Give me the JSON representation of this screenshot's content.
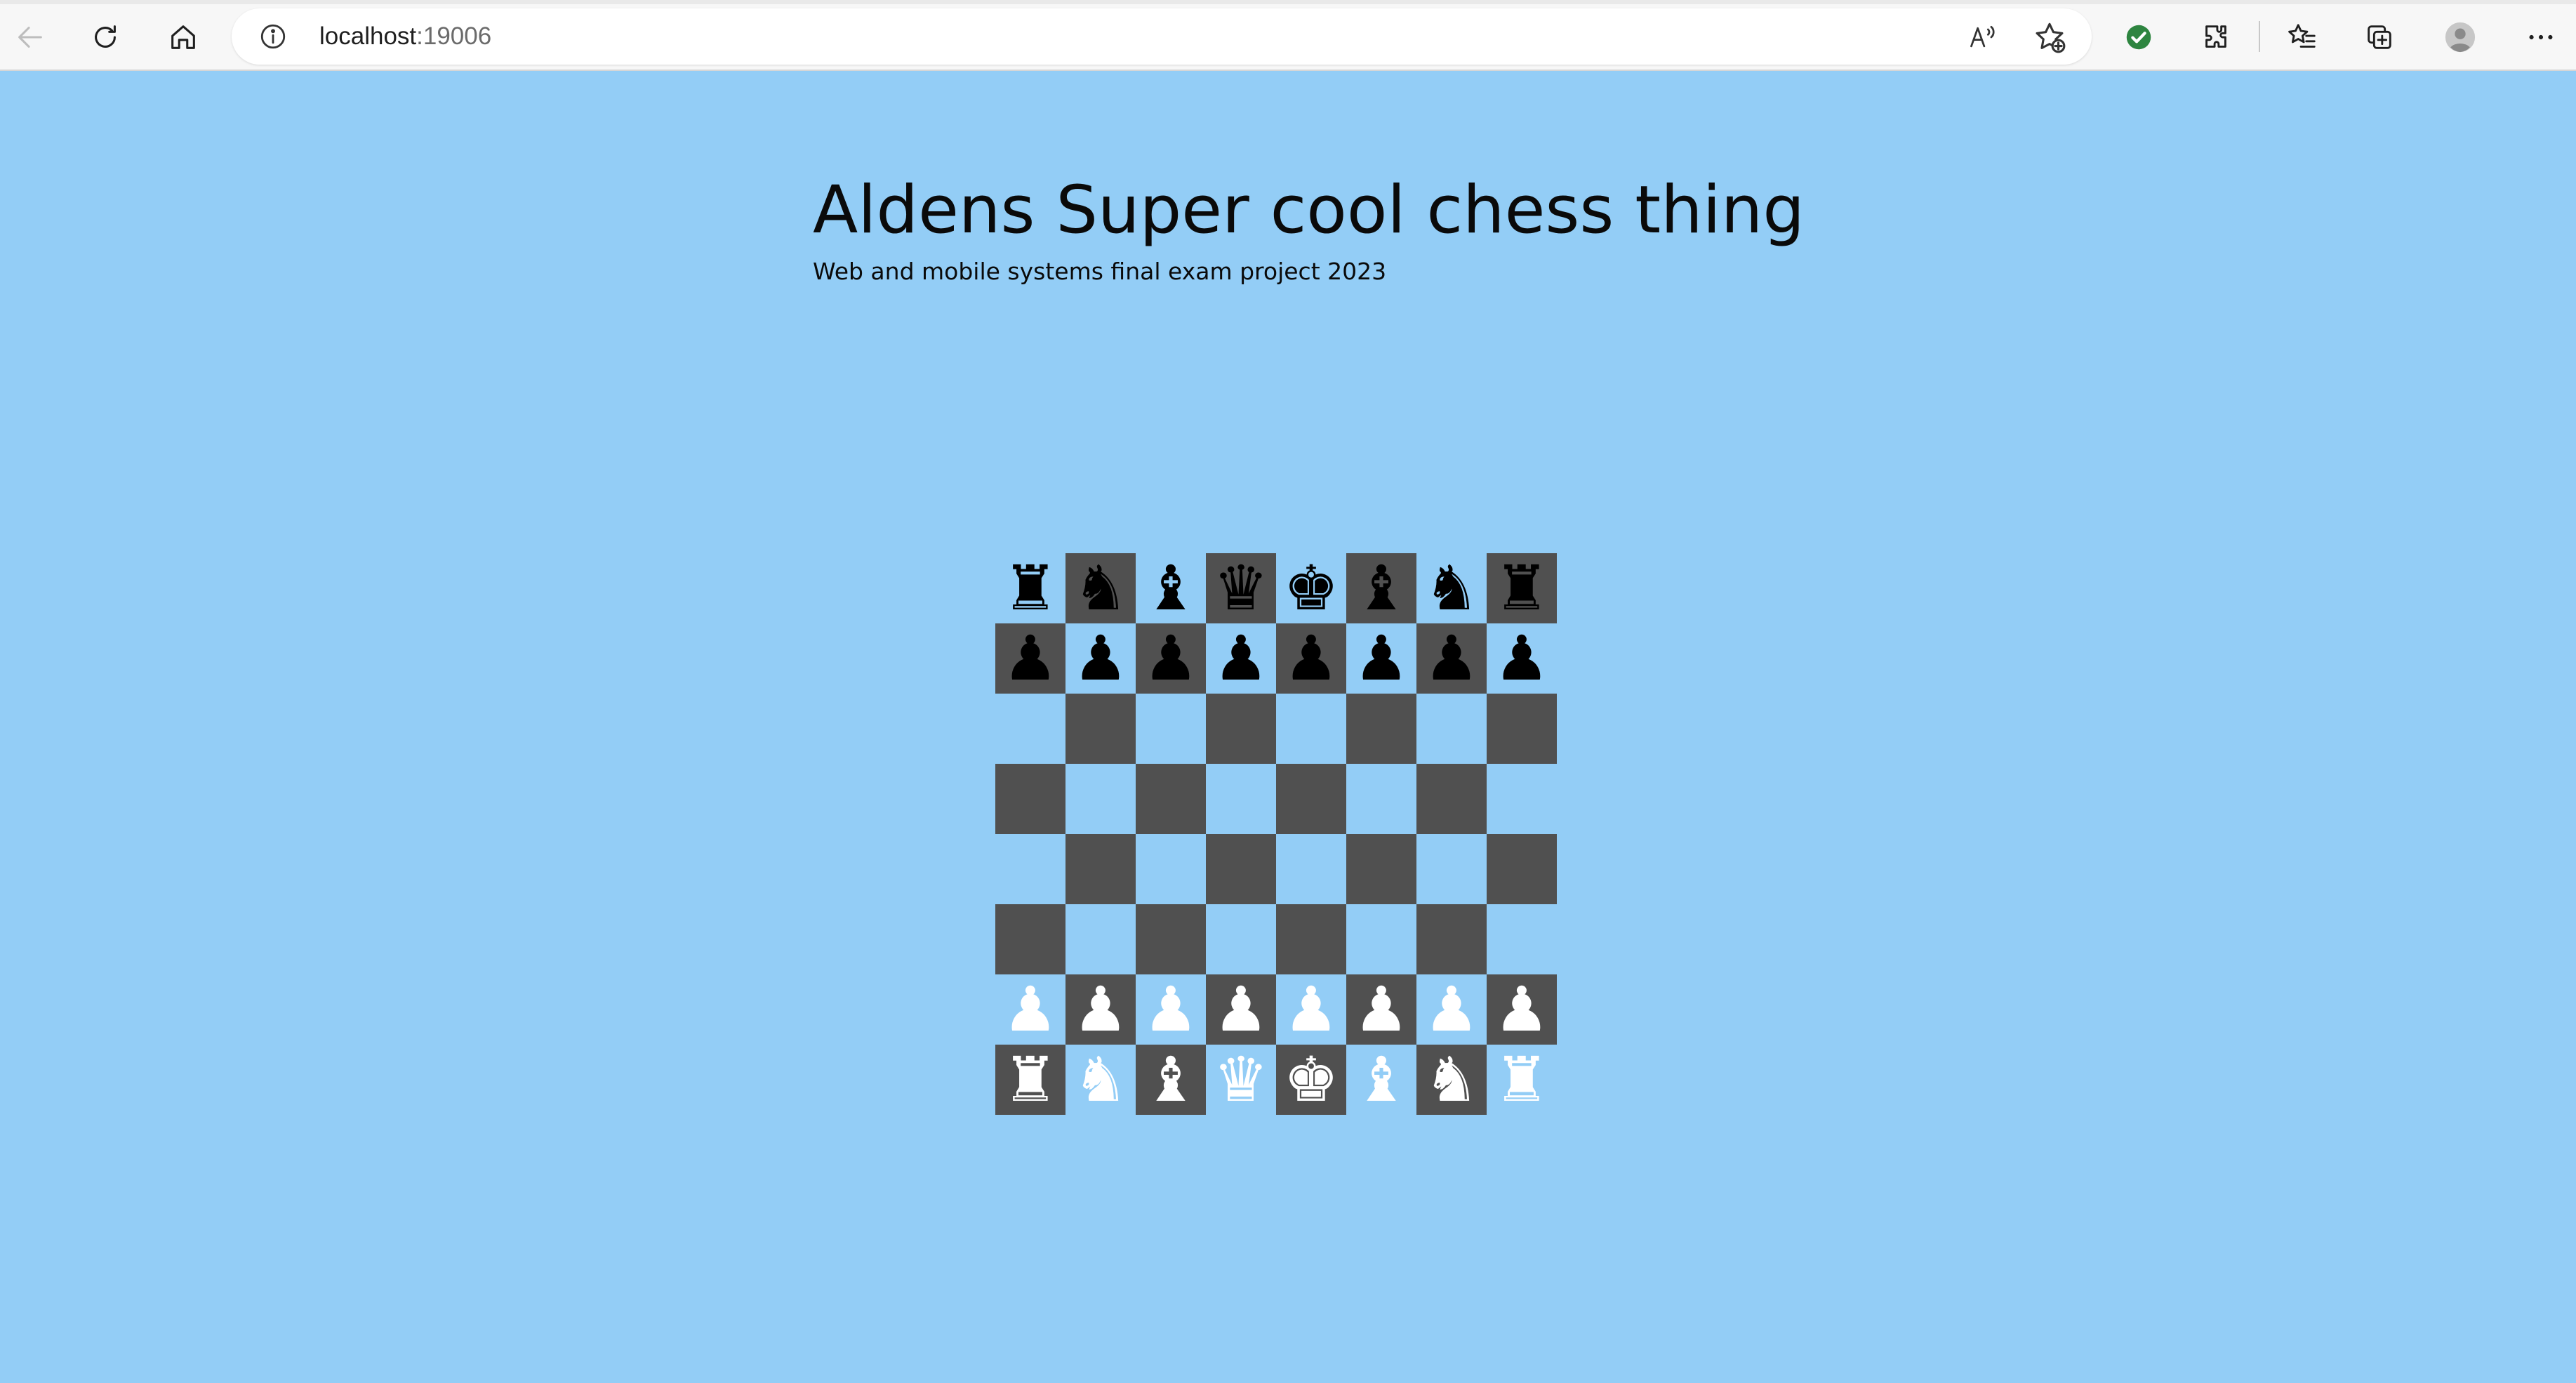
{
  "browser": {
    "url_host": "localhost",
    "url_port": ":19006",
    "read_aloud_label": "A⁾",
    "icons": {
      "back": "back-arrow-icon",
      "refresh": "refresh-icon",
      "home": "home-icon",
      "info": "info-icon",
      "read_aloud": "read-aloud-icon",
      "add_favorite": "add-favorite-icon",
      "extension_check": "check-circle-icon",
      "extensions": "puzzle-icon",
      "favorites": "favorites-icon",
      "collections": "collections-icon",
      "profile": "profile-avatar-icon",
      "more": "more-icon"
    }
  },
  "page": {
    "title": "Aldens Super cool chess thing",
    "subtitle": "Web and mobile systems final exam project 2023"
  },
  "board": {
    "colors": {
      "dark_square": "#505050",
      "light_square": "#93cdf6",
      "page_background": "#93cdf6"
    },
    "ranks": [
      [
        "♜",
        "♞",
        "♝",
        "♛",
        "♚",
        "♝",
        "♞",
        "♜"
      ],
      [
        "♟",
        "♟",
        "♟",
        "♟",
        "♟",
        "♟",
        "♟",
        "♟"
      ],
      [
        "",
        "",
        "",
        "",
        "",
        "",
        "",
        ""
      ],
      [
        "",
        "",
        "",
        "",
        "",
        "",
        "",
        ""
      ],
      [
        "",
        "",
        "",
        "",
        "",
        "",
        "",
        ""
      ],
      [
        "",
        "",
        "",
        "",
        "",
        "",
        "",
        ""
      ],
      [
        "♟",
        "♟",
        "♟",
        "♟",
        "♟",
        "♟",
        "♟",
        "♟"
      ],
      [
        "♜",
        "♞",
        "♝",
        "♛",
        "♚",
        "♝",
        "♞",
        "♜"
      ]
    ],
    "piece_colors": [
      [
        "black",
        "black",
        "black",
        "black",
        "black",
        "black",
        "black",
        "black"
      ],
      [
        "black",
        "black",
        "black",
        "black",
        "black",
        "black",
        "black",
        "black"
      ],
      [
        "",
        "",
        "",
        "",
        "",
        "",
        "",
        ""
      ],
      [
        "",
        "",
        "",
        "",
        "",
        "",
        "",
        ""
      ],
      [
        "",
        "",
        "",
        "",
        "",
        "",
        "",
        ""
      ],
      [
        "",
        "",
        "",
        "",
        "",
        "",
        "",
        ""
      ],
      [
        "white",
        "white",
        "white",
        "white",
        "white",
        "white",
        "white",
        "white"
      ],
      [
        "white",
        "white",
        "white",
        "white",
        "white",
        "white",
        "white",
        "white"
      ]
    ],
    "piece_names": [
      [
        "rook",
        "knight",
        "bishop",
        "queen",
        "king",
        "bishop",
        "knight",
        "rook"
      ],
      [
        "pawn",
        "pawn",
        "pawn",
        "pawn",
        "pawn",
        "pawn",
        "pawn",
        "pawn"
      ],
      [
        "",
        "",
        "",
        "",
        "",
        "",
        "",
        ""
      ],
      [
        "",
        "",
        "",
        "",
        "",
        "",
        "",
        ""
      ],
      [
        "",
        "",
        "",
        "",
        "",
        "",
        "",
        ""
      ],
      [
        "",
        "",
        "",
        "",
        "",
        "",
        "",
        ""
      ],
      [
        "pawn",
        "pawn",
        "pawn",
        "pawn",
        "pawn",
        "pawn",
        "pawn",
        "pawn"
      ],
      [
        "rook",
        "knight",
        "bishop",
        "queen",
        "king",
        "bishop",
        "knight",
        "rook"
      ]
    ]
  }
}
